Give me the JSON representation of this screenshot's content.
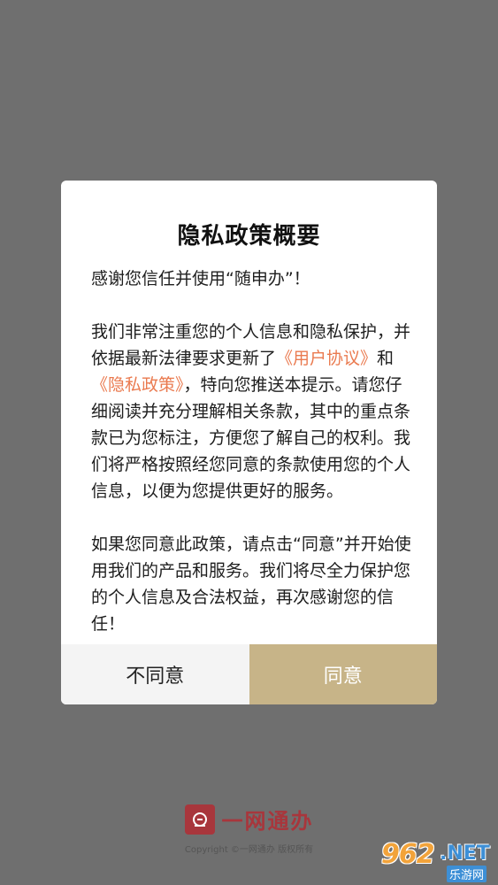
{
  "dialog": {
    "title": "隐私政策概要",
    "greeting": "感谢您信任并使用“随申办”！",
    "p2_before": "我们非常注重您的个人信息和隐私保护，并依据最新法律要求更新了",
    "link_user_agreement": "《用户协议》",
    "p2_and": "和",
    "link_privacy_policy": "《隐私政策》",
    "p2_after": "，特向您推送本提示。请您仔细阅读并充分理解相关条款，其中的重点条款已为您标注，方便您了解自己的权利。我们将严格按照经您同意的条款使用您的个人信息，以便为您提供更好的服务。",
    "p3": "如果您同意此政策，请点击“同意”并开始使用我们的产品和服务。我们将尽全力保护您的个人信息及合法权益，再次感谢您的信任！",
    "decline_label": "不同意",
    "agree_label": "同意"
  },
  "footer": {
    "brand_name": "一网通办",
    "copyright": "Copyright ©一网通办 版权所有"
  },
  "watermark": {
    "number": "962",
    "suffix": ".NET",
    "sub": "乐游网"
  },
  "colors": {
    "overlay": "#6f6f6f",
    "link": "#ea7a4f",
    "agree_button": "#c7b488",
    "brand": "#a8363c"
  }
}
